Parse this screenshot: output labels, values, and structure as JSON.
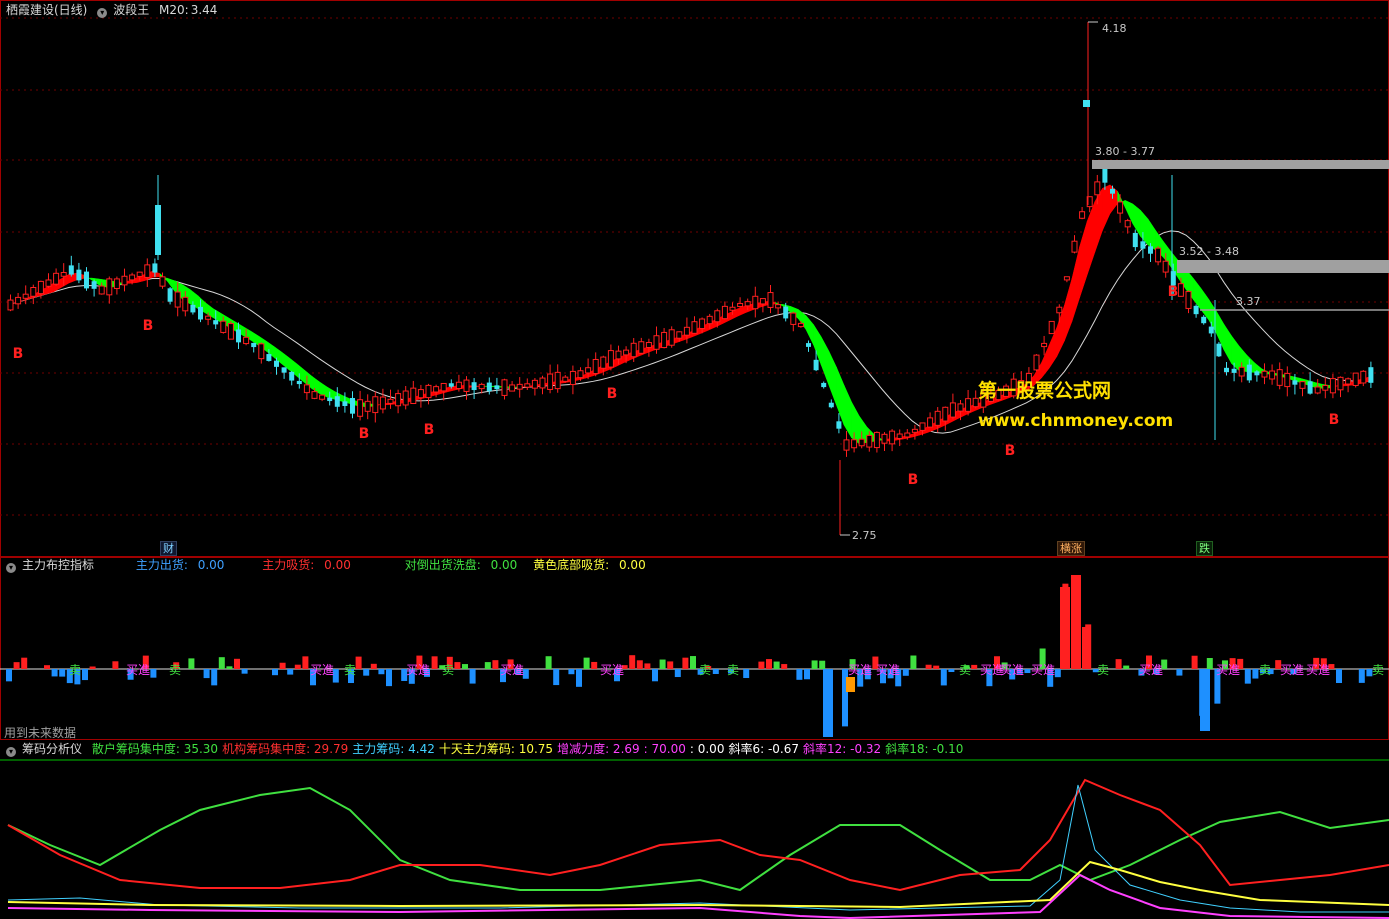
{
  "header": {
    "stock_name": "栖霞建设(日线)",
    "indicator_name": "波段王",
    "m20_label": "M20:",
    "m20_value": "3.44"
  },
  "main_chart": {
    "price_labels": [
      "4.18",
      "3.80 - 3.77",
      "3.52 - 3.48",
      "3.37",
      "2.75"
    ],
    "buy_marker": "B",
    "event_tags": [
      "财",
      "横涨",
      "跌"
    ],
    "watermark_cn": "第一股票公式网",
    "watermark_url": "www.chnmoney.com"
  },
  "panel2": {
    "title": "主力布控指标",
    "items": [
      {
        "label": "主力出货:",
        "value": "0.00",
        "color": "#3fa0ff"
      },
      {
        "label": "主力吸货:",
        "value": "0.00",
        "color": "#ff3030"
      },
      {
        "label": "对倒出货洗盘:",
        "value": "0.00",
        "color": "#40e040"
      },
      {
        "label": "黄色底部吸货:",
        "value": "0.00",
        "color": "#ffff40"
      }
    ],
    "sell_label": "卖",
    "buy_label": "买進",
    "footer": "用到未来数据"
  },
  "panel3": {
    "title": "筹码分析仪",
    "items": [
      {
        "label": "散户筹码集中度:",
        "value": "35.30",
        "color": "#40e040"
      },
      {
        "label": "机构筹码集中度:",
        "value": "29.79",
        "color": "#ff3030"
      },
      {
        "label": "主力筹码:",
        "value": "4.42",
        "color": "#40d0ff"
      },
      {
        "label": "十天主力筹码:",
        "value": "10.75",
        "color": "#ffff40"
      },
      {
        "label": "增减力度:",
        "value": "2.69",
        "color": "#ff40ff"
      },
      {
        "label": ":",
        "value": "70.00",
        "color": "#ff40ff"
      },
      {
        "label": ":",
        "value": "0.00",
        "color": "#ffffff"
      },
      {
        "label": "斜率6:",
        "value": "-0.67",
        "color": "#ffffff"
      },
      {
        "label": "斜率12:",
        "value": "-0.32",
        "color": "#ff40ff"
      },
      {
        "label": "斜率18:",
        "value": "-0.10",
        "color": "#40e040"
      }
    ]
  },
  "colors": {
    "up": "#ff2020",
    "down": "#40e0f0",
    "band_up": "#ff0000",
    "band_down": "#00ff00",
    "grid": "#800000",
    "border": "#a00000"
  }
}
